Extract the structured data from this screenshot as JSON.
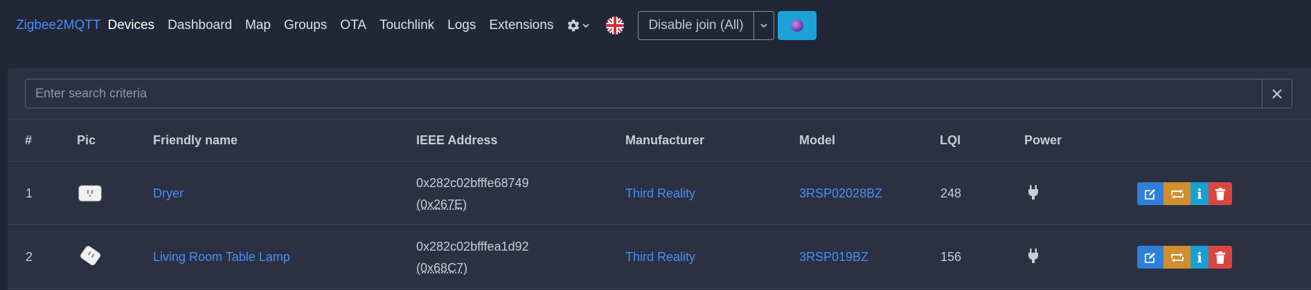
{
  "navbar": {
    "brand": "Zigbee2MQTT",
    "links": [
      "Devices",
      "Dashboard",
      "Map",
      "Groups",
      "OTA",
      "Touchlink",
      "Logs",
      "Extensions"
    ],
    "active": "Devices",
    "settings_icon": "gear-icon",
    "language_icon": "uk-flag-icon",
    "join_button_label": "Disable join (All)",
    "join_caret_icon": "chevron-down-icon",
    "permit_icon": "zigbee-orb-icon"
  },
  "search": {
    "placeholder": "Enter search criteria",
    "value": "",
    "clear_icon": "close-icon"
  },
  "table": {
    "headers": [
      "#",
      "Pic",
      "Friendly name",
      "IEEE Address",
      "Manufacturer",
      "Model",
      "LQI",
      "Power"
    ],
    "rows": [
      {
        "index": "1",
        "pic_icon": "smart-plug-icon",
        "friendly_name": "Dryer",
        "ieee": "0x282c02bfffe68749",
        "nwk": "(0x267E)",
        "manufacturer": "Third Reality",
        "model": "3RSP02028BZ",
        "lqi": "248",
        "power_icon": "plug-icon"
      },
      {
        "index": "2",
        "pic_icon": "smart-plug-icon",
        "friendly_name": "Living Room Table Lamp",
        "ieee": "0x282c02bfffea1d92",
        "nwk": "(0x68C7)",
        "manufacturer": "Third Reality",
        "model": "3RSP019BZ",
        "lqi": "156",
        "power_icon": "plug-icon"
      }
    ],
    "action_icons": [
      "edit-icon",
      "rename-icon",
      "info-icon",
      "trash-icon"
    ],
    "info_glyph": "i"
  },
  "colors": {
    "background": "#222736",
    "card": "#2b3142",
    "link": "#4b8df8",
    "edit": "#2f7fd9",
    "rename": "#d38e2e",
    "info": "#1a9fd2",
    "remove": "#d9463f"
  }
}
